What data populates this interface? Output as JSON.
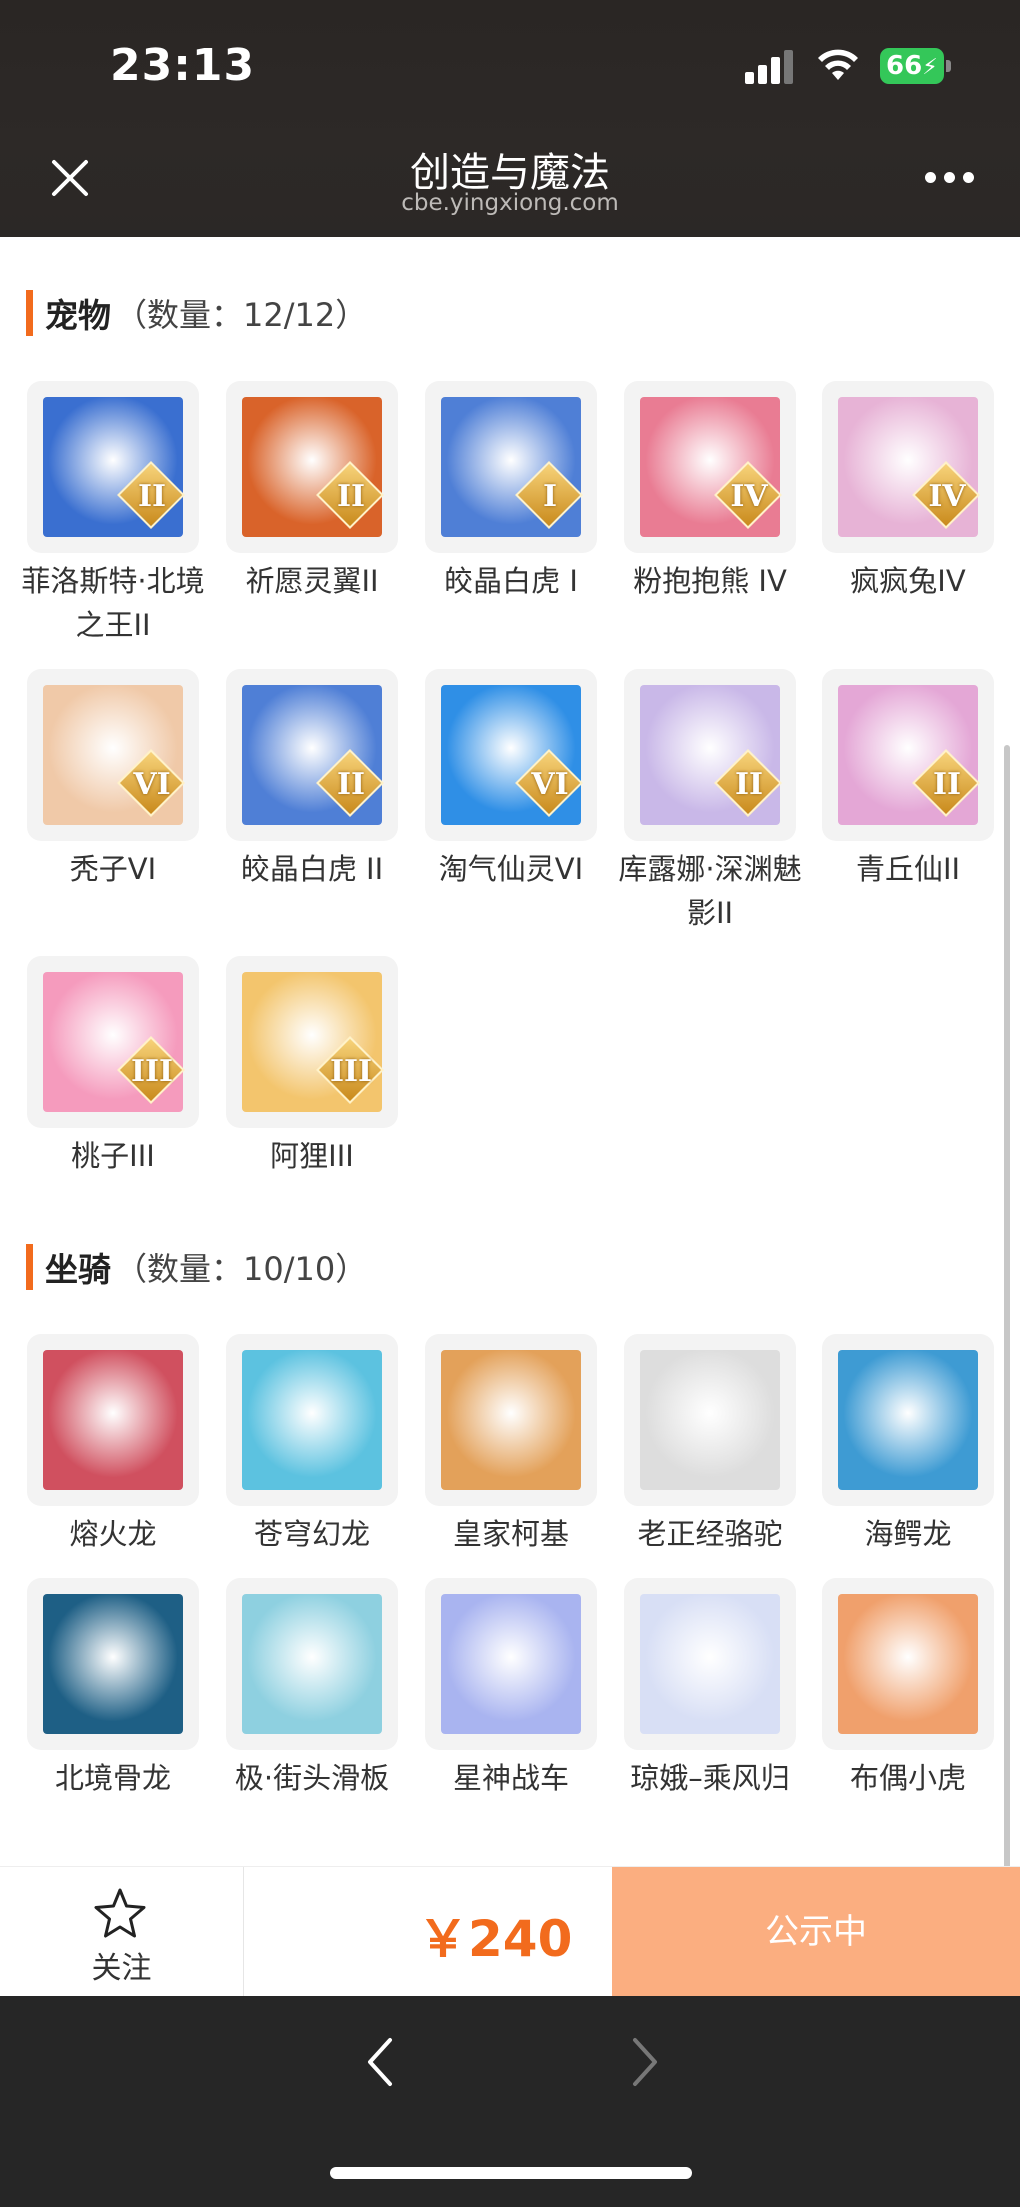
{
  "status_bar": {
    "time": "23:13",
    "battery": "66"
  },
  "nav": {
    "title": "创造与魔法",
    "subtitle": "cbe.yingxiong.com"
  },
  "pets": {
    "title": "宠物",
    "count": "（数量：12/12）",
    "items": [
      {
        "name": "菲洛斯特·北境之王II",
        "badge": "II",
        "icon": "frost-dragon-king-icon",
        "color": "#3a6fd0"
      },
      {
        "name": "祈愿灵翼II",
        "badge": "II",
        "icon": "griffin-icon",
        "color": "#d9632a"
      },
      {
        "name": "皎晶白虎 I",
        "badge": "I",
        "icon": "white-tiger-icon",
        "color": "#4f7fd6"
      },
      {
        "name": "粉抱抱熊 IV",
        "badge": "IV",
        "icon": "pink-bear-icon",
        "color": "#e97c93"
      },
      {
        "name": "疯疯兔IV",
        "badge": "IV",
        "icon": "crazy-rabbit-icon",
        "color": "#e7b3d6"
      },
      {
        "name": "秃子VI",
        "badge": "VI",
        "icon": "bald-head-icon",
        "color": "#f0c9a8"
      },
      {
        "name": "皎晶白虎 II",
        "badge": "II",
        "icon": "white-tiger-icon",
        "color": "#4f7fd6"
      },
      {
        "name": "淘气仙灵VI",
        "badge": "VI",
        "icon": "blue-pup-icon",
        "color": "#2f8fe6"
      },
      {
        "name": "库露娜·深渊魅影II",
        "badge": "II",
        "icon": "abyss-phantom-icon",
        "color": "#c9b8e8"
      },
      {
        "name": "青丘仙II",
        "badge": "II",
        "icon": "fox-spirit-icon",
        "color": "#e4a7d6"
      },
      {
        "name": "桃子III",
        "badge": "III",
        "icon": "peach-bunny-icon",
        "color": "#f59bbd"
      },
      {
        "name": "阿狸III",
        "badge": "III",
        "icon": "tiger-hat-icon",
        "color": "#f3c56d"
      }
    ]
  },
  "mounts": {
    "title": "坐骑",
    "count": "（数量：10/10）",
    "items": [
      {
        "name": "熔火龙",
        "icon": "lava-dragon-icon",
        "color": "#d0505f"
      },
      {
        "name": "苍穹幻龙",
        "icon": "sky-dragon-icon",
        "color": "#5cc2e0"
      },
      {
        "name": "皇家柯基",
        "icon": "royal-corgi-icon",
        "color": "#e3a15a"
      },
      {
        "name": "老正经骆驼",
        "icon": "camel-icon",
        "color": "#dddddd"
      },
      {
        "name": "海鳄龙",
        "icon": "sea-dragon-icon",
        "color": "#3e9bd3"
      },
      {
        "name": "北境骨龙",
        "icon": "bone-dragon-icon",
        "color": "#1e5f85"
      },
      {
        "name": "极·街头滑板",
        "icon": "skateboard-icon",
        "color": "#8ed0e0"
      },
      {
        "name": "星神战车",
        "icon": "star-chariot-icon",
        "color": "#a9b4f0"
      },
      {
        "name": "琼娥–乘风归",
        "icon": "moon-fairy-icon",
        "color": "#d8dff5"
      },
      {
        "name": "布偶小虎",
        "icon": "rag-tiger-icon",
        "color": "#f0a06c"
      }
    ]
  },
  "footer": {
    "follow_label": "关注",
    "price": "￥240",
    "status_button": "公示中"
  }
}
